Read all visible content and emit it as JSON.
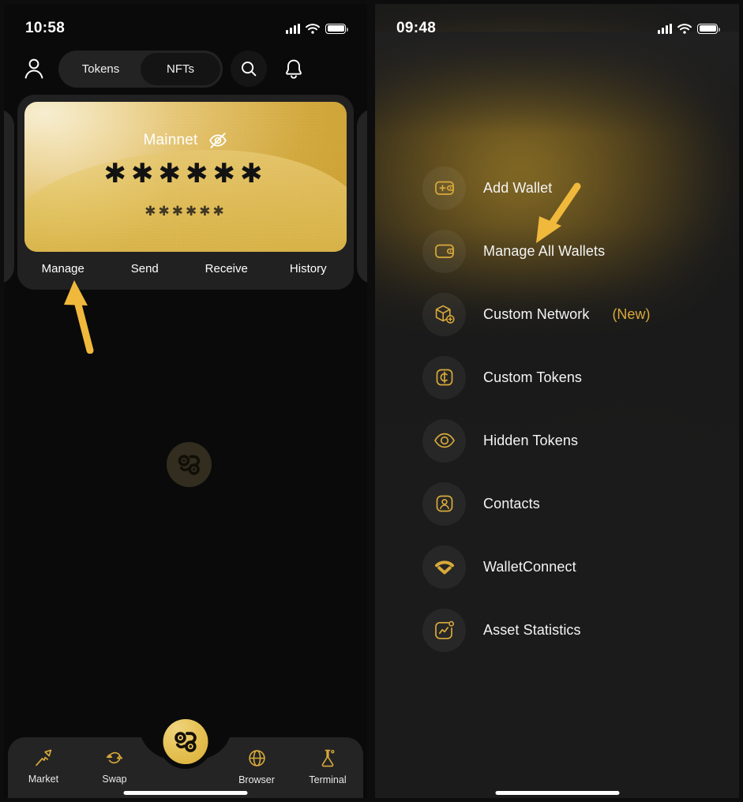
{
  "accent": "#e0b13f",
  "left_screen": {
    "status_bar": {
      "time": "10:58",
      "signal_icon": "cellular-bars-icon",
      "wifi_icon": "wifi-icon",
      "battery_icon": "battery-icon"
    },
    "top_bar": {
      "avatar_icon": "person-icon",
      "tabs": [
        {
          "label": "Tokens",
          "active": false
        },
        {
          "label": "NFTs",
          "active": true
        }
      ],
      "search_icon": "search-icon",
      "notifications_icon": "bell-icon"
    },
    "wallet_card": {
      "network": "Mainnet",
      "hide_balance_icon": "eye-off-icon",
      "balance_masked": "✱✱✱✱✱✱",
      "balance_sub_masked": "✱✱✱✱✱✱",
      "actions": [
        "Manage",
        "Send",
        "Receive",
        "History"
      ]
    },
    "watermark_icon": "app-logo-watermark",
    "bottom_nav": {
      "items": [
        {
          "label": "Market",
          "icon": "market-pin-icon"
        },
        {
          "label": "Swap",
          "icon": "swap-arrows-icon"
        },
        {
          "label": "Browser",
          "icon": "globe-icon"
        },
        {
          "label": "Terminal",
          "icon": "flask-icon"
        }
      ],
      "fab_icon": "app-logo-icon"
    }
  },
  "right_screen": {
    "status_bar": {
      "time": "09:48",
      "signal_icon": "cellular-bars-icon",
      "wifi_icon": "wifi-icon",
      "battery_icon": "battery-icon"
    },
    "menu": [
      {
        "label": "Add Wallet",
        "badge": "",
        "icon": "wallet-plus-icon"
      },
      {
        "label": "Manage All Wallets",
        "badge": "",
        "icon": "wallet-icon"
      },
      {
        "label": "Custom Network",
        "badge": "(New)",
        "icon": "cube-plus-icon"
      },
      {
        "label": "Custom Tokens",
        "badge": "",
        "icon": "coin-square-icon"
      },
      {
        "label": "Hidden Tokens",
        "badge": "",
        "icon": "eye-icon"
      },
      {
        "label": "Contacts",
        "badge": "",
        "icon": "contact-card-icon"
      },
      {
        "label": "WalletConnect",
        "badge": "",
        "icon": "walletconnect-icon"
      },
      {
        "label": "Asset Statistics",
        "badge": "",
        "icon": "chart-square-icon"
      }
    ]
  },
  "annotations": {
    "left_arrow": {
      "points_to": "Manage",
      "icon": "annotation-arrow-up"
    },
    "right_arrow": {
      "points_to": "Manage All Wallets",
      "icon": "annotation-arrow-down"
    }
  }
}
